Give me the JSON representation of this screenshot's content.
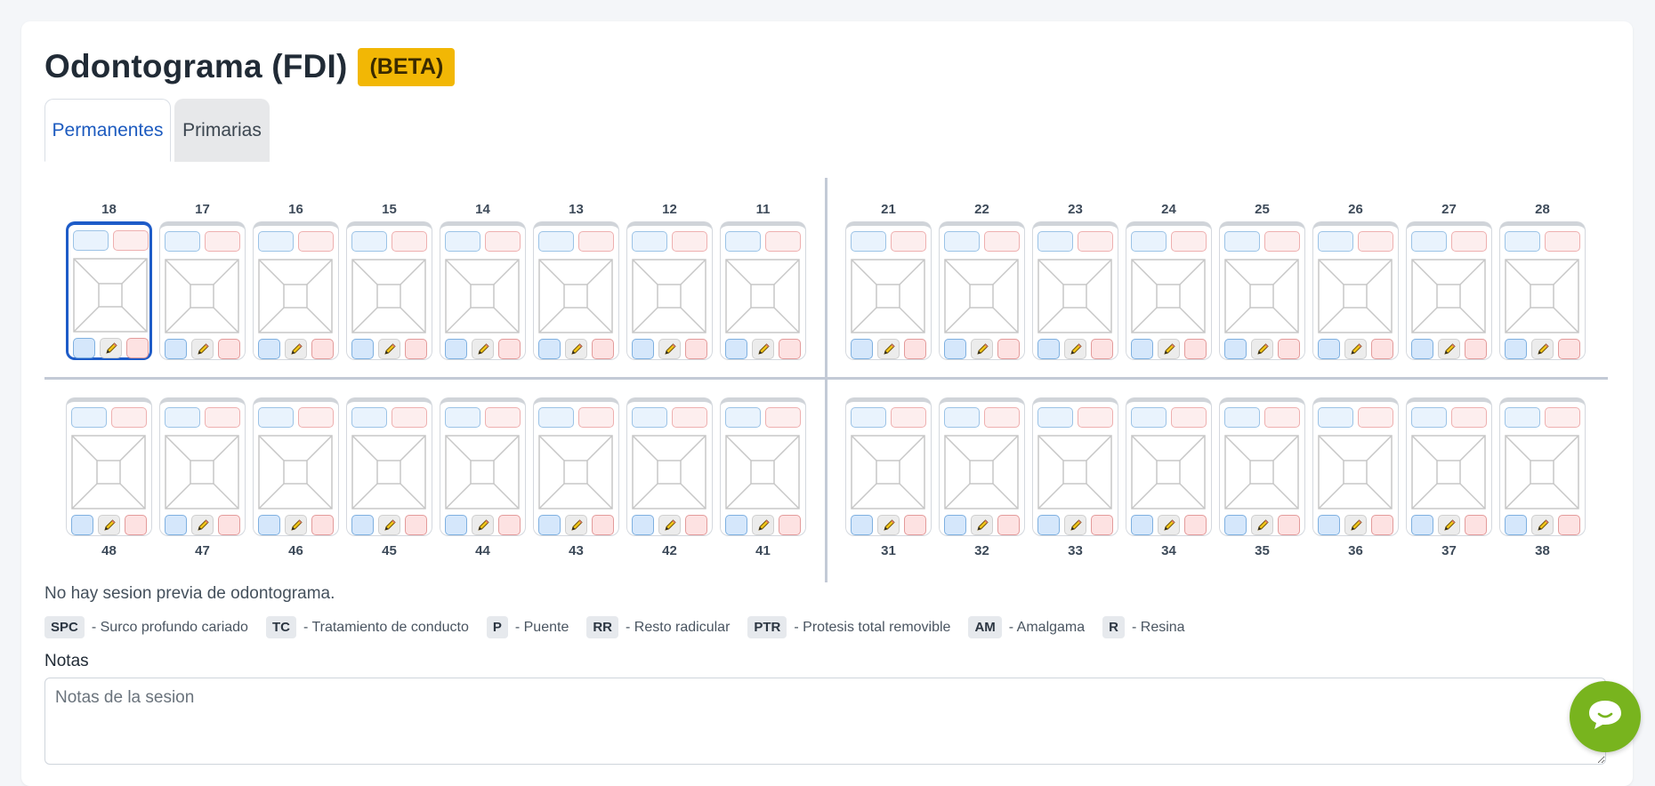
{
  "header": {
    "title": "Odontograma (FDI)",
    "badge": "(BETA)"
  },
  "tabs": [
    {
      "label": "Permanentes",
      "active": true
    },
    {
      "label": "Primarias",
      "active": false
    }
  ],
  "teeth": {
    "upper_right": [
      "18",
      "17",
      "16",
      "15",
      "14",
      "13",
      "12",
      "11"
    ],
    "upper_left": [
      "21",
      "22",
      "23",
      "24",
      "25",
      "26",
      "27",
      "28"
    ],
    "lower_right": [
      "48",
      "47",
      "46",
      "45",
      "44",
      "43",
      "42",
      "41"
    ],
    "lower_left": [
      "31",
      "32",
      "33",
      "34",
      "35",
      "36",
      "37",
      "38"
    ],
    "selected": "18"
  },
  "status": {
    "no_session": "No hay sesion previa de odontograma."
  },
  "legend": [
    {
      "code": "SPC",
      "desc": "- Surco profundo cariado"
    },
    {
      "code": "TC",
      "desc": "- Tratamiento de conducto"
    },
    {
      "code": "P",
      "desc": "- Puente"
    },
    {
      "code": "RR",
      "desc": "- Resto radicular"
    },
    {
      "code": "PTR",
      "desc": "- Protesis total removible"
    },
    {
      "code": "AM",
      "desc": "- Amalgama"
    },
    {
      "code": "R",
      "desc": "- Resina"
    }
  ],
  "notes": {
    "label": "Notas",
    "placeholder": "Notas de la sesion",
    "value": ""
  },
  "chat": {
    "icon": "chat-bubble-icon"
  },
  "colors": {
    "accent": "#1e5cc8",
    "badge": "#f2b705",
    "chat": "#78b41e"
  }
}
